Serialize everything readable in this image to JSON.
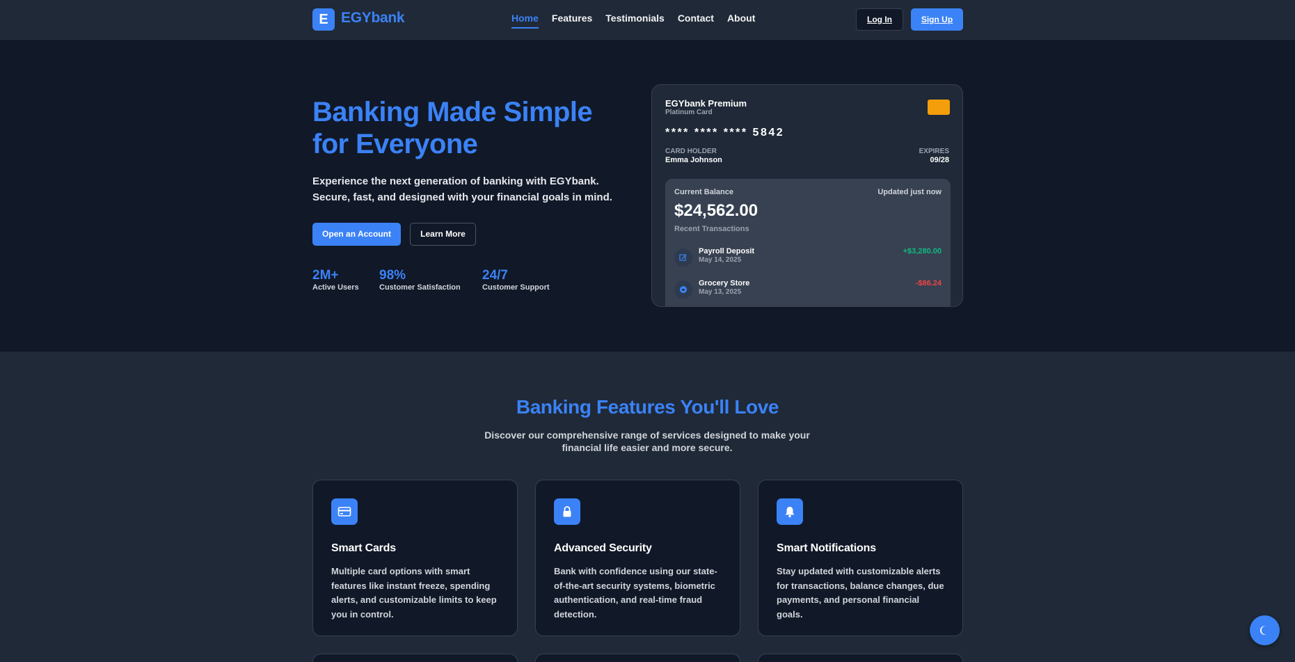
{
  "brand": {
    "logo_letter": "E",
    "name": "EGYbank"
  },
  "nav": {
    "links": [
      "Home",
      "Features",
      "Testimonials",
      "Contact",
      "About"
    ],
    "active": "Home",
    "login": "Log In",
    "signup": "Sign Up"
  },
  "hero": {
    "title": "Banking Made Simple for Everyone",
    "subtitle": "Experience the next generation of banking with EGYbank. Secure, fast, and designed with your financial goals in mind.",
    "primary_cta": "Open an Account",
    "secondary_cta": "Learn More",
    "stats": [
      {
        "value": "2M+",
        "label": "Active Users"
      },
      {
        "value": "98%",
        "label": "Customer Satisfaction"
      },
      {
        "value": "24/7",
        "label": "Customer Support"
      }
    ]
  },
  "card": {
    "name": "EGYbank Premium",
    "type": "Platinum Card",
    "number": "**** **** **** 5842",
    "holder_label": "CARD HOLDER",
    "holder_name": "Emma Johnson",
    "expires_label": "EXPIRES",
    "expires_value": "09/28",
    "balance_label": "Current Balance",
    "updated": "Updated just now",
    "balance": "$24,562.00",
    "recent_label": "Recent Transactions",
    "transactions": [
      {
        "name": "Payroll Deposit",
        "date": "May 14, 2025",
        "amount": "+$3,280.00",
        "icon": "edit-icon",
        "color": "#10b981"
      },
      {
        "name": "Grocery Store",
        "date": "May 13, 2025",
        "amount": "-$86.24",
        "icon": "cart-icon",
        "color": "#ef4444"
      }
    ]
  },
  "features": {
    "title": "Banking Features You'll Love",
    "subtitle": "Discover our comprehensive range of services designed to make your financial life easier and more secure.",
    "items": [
      {
        "title": "Smart Cards",
        "icon": "credit-card-icon",
        "desc": "Multiple card options with smart features like instant freeze, spending alerts, and customizable limits to keep you in control."
      },
      {
        "title": "Advanced Security",
        "icon": "lock-icon",
        "desc": "Bank with confidence using our state-of-the-art security systems, biometric authentication, and real-time fraud detection."
      },
      {
        "title": "Smart Notifications",
        "icon": "bell-icon",
        "desc": "Stay updated with customizable alerts for transactions, balance changes, due payments, and personal financial goals."
      }
    ]
  },
  "theme_toggle": {
    "icon": "moon-icon"
  },
  "colors": {
    "accent": "#3b82f6",
    "positive": "#10b981",
    "negative": "#ef4444",
    "chip": "#f59e0b"
  }
}
